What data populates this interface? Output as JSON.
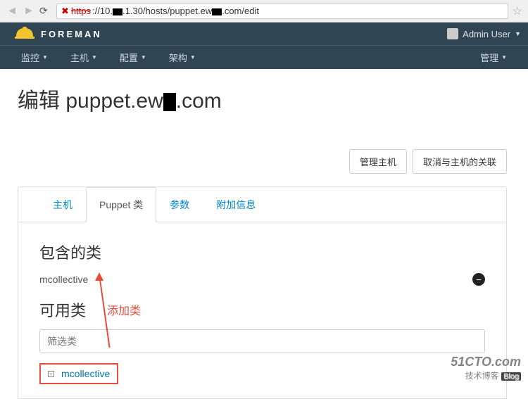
{
  "url": {
    "scheme_struck": "https",
    "rest": "://10.██.1.30/hosts/puppet.ew██.com/edit"
  },
  "header": {
    "brand": "FOREMAN",
    "user_label": "Admin User"
  },
  "nav": {
    "items": [
      "监控",
      "主机",
      "配置",
      "架构"
    ],
    "right": "管理"
  },
  "page": {
    "title_prefix": "编辑 puppet.ew",
    "title_suffix": ".com"
  },
  "buttons": {
    "manage_host": "管理主机",
    "unlink_host": "取消与主机的关联"
  },
  "tabs": {
    "host": "主机",
    "puppet": "Puppet 类",
    "params": "参数",
    "extra": "附加信息"
  },
  "included": {
    "title": "包含的类",
    "items": [
      "mcollective"
    ]
  },
  "available": {
    "title": "可用类",
    "annotation": "添加类",
    "filter_placeholder": "筛选类",
    "items": [
      "mcollective"
    ]
  },
  "watermark": {
    "line1": "51CTO.com",
    "line2": "技术博客",
    "tag": "Blog"
  }
}
